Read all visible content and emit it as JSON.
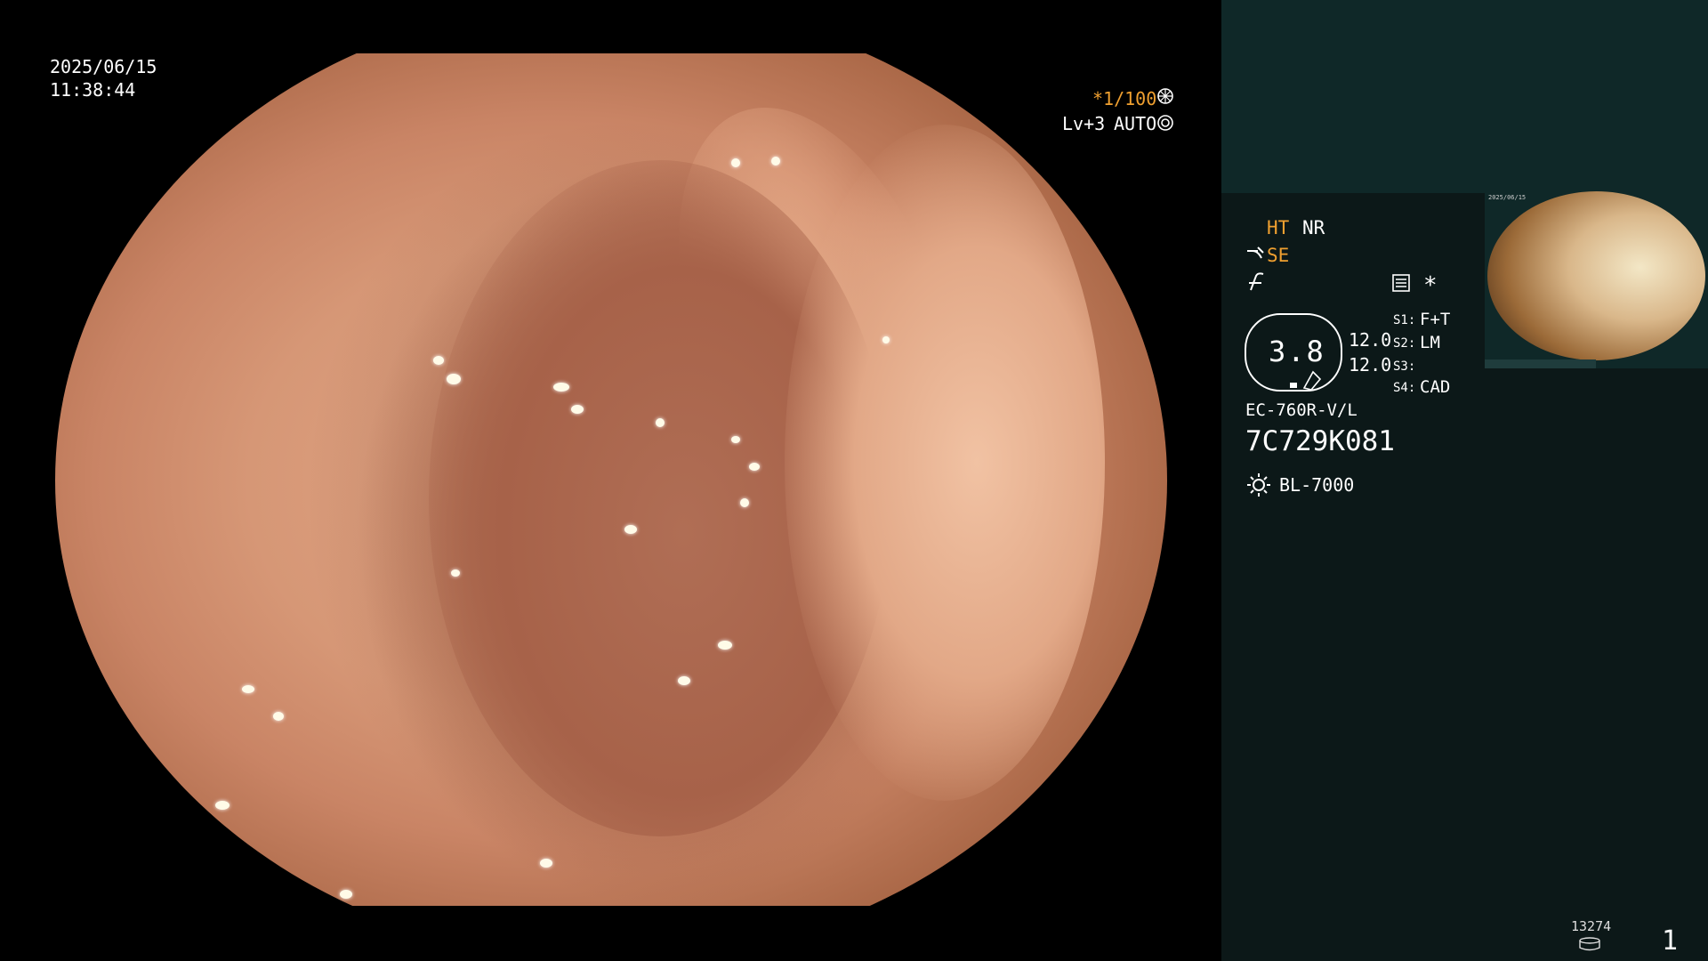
{
  "overlay": {
    "date": "2025/06/15",
    "time": "11:38:44",
    "shutter": "*1/100",
    "shutter_icon": "aperture-icon",
    "level": "Lv+3",
    "exposure": "AUTO",
    "exposure_icon": "target-icon"
  },
  "panel": {
    "ht": "HT",
    "nr": "NR",
    "se": "SE",
    "asterisk": "*",
    "zoom": "3.8",
    "values": [
      "12.0",
      "12.0"
    ],
    "switches": [
      {
        "key": "S1:",
        "value": "F+T"
      },
      {
        "key": "S2:",
        "value": "LM"
      },
      {
        "key": "S3:",
        "value": ""
      },
      {
        "key": "S4:",
        "value": "CAD"
      }
    ],
    "scope_model": "EC-760R-V/L",
    "serial": "7C729K081",
    "light_source": "BL-7000",
    "counter": "13274",
    "page": "1",
    "thumbnail_time": "2025/06/15"
  },
  "colors": {
    "accent_orange": "#f0a030",
    "panel_bg": "#0c1818",
    "panel_top_bg": "#0f2828"
  }
}
